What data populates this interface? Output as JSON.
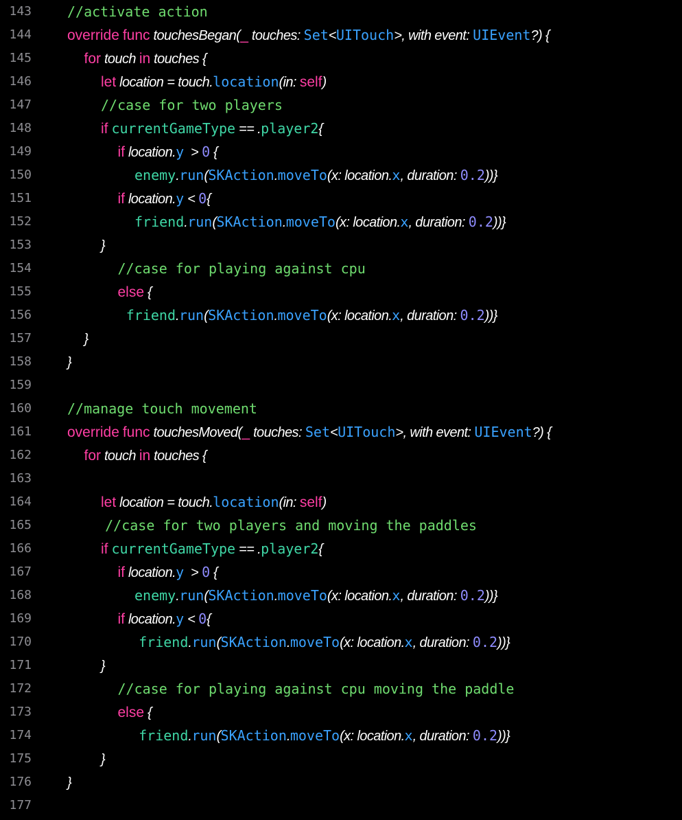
{
  "editor": {
    "colors": {
      "background": "#000000",
      "line_number": "#8e8e93",
      "plain": "#ffffff",
      "keyword": "#ff3fa4",
      "type": "#3aa2ff",
      "method": "#3aa2ff",
      "property": "#3fd7a6",
      "comment": "#6fdc6f",
      "number": "#8f8cff"
    },
    "lines": [
      {
        "num": "143",
        "indent": 0,
        "tokens": [
          {
            "t": "comment",
            "v": "//activate action"
          }
        ]
      },
      {
        "num": "144",
        "indent": 0,
        "tokens": [
          {
            "t": "kw",
            "v": "override"
          },
          {
            "t": "plain",
            "v": " "
          },
          {
            "t": "kw",
            "v": "func"
          },
          {
            "t": "plain",
            "v": " touchesBegan("
          },
          {
            "t": "kw",
            "v": "_"
          },
          {
            "t": "plain",
            "v": " touches: "
          },
          {
            "t": "type",
            "v": "Set"
          },
          {
            "t": "plain",
            "v": "<"
          },
          {
            "t": "type",
            "v": "UITouch"
          },
          {
            "t": "plain",
            "v": ">, with event: "
          },
          {
            "t": "type",
            "v": "UIEvent"
          },
          {
            "t": "plain",
            "v": "?) {"
          }
        ]
      },
      {
        "num": "145",
        "indent": 1,
        "tokens": [
          {
            "t": "kw",
            "v": "for"
          },
          {
            "t": "plain",
            "v": " touch "
          },
          {
            "t": "kw",
            "v": "in"
          },
          {
            "t": "plain",
            "v": " touches {"
          }
        ]
      },
      {
        "num": "146",
        "indent": 2,
        "tokens": [
          {
            "t": "kw",
            "v": "let"
          },
          {
            "t": "plain",
            "v": " location = touch."
          },
          {
            "t": "method",
            "v": "location"
          },
          {
            "t": "plain",
            "v": "(in: "
          },
          {
            "t": "kw",
            "v": "self"
          },
          {
            "t": "plain",
            "v": ")"
          }
        ]
      },
      {
        "num": "147",
        "indent": 2,
        "tokens": [
          {
            "t": "comment",
            "v": "//case for two players"
          }
        ]
      },
      {
        "num": "148",
        "indent": 2,
        "tokens": [
          {
            "t": "kw",
            "v": "if"
          },
          {
            "t": "plain",
            "v": " "
          },
          {
            "t": "prop",
            "v": "currentGameType"
          },
          {
            "t": "plain",
            "v": " == ."
          },
          {
            "t": "prop",
            "v": "player2"
          },
          {
            "t": "plain",
            "v": "{"
          }
        ]
      },
      {
        "num": "149",
        "indent": 3,
        "tokens": [
          {
            "t": "kw",
            "v": "if"
          },
          {
            "t": "plain",
            "v": " location."
          },
          {
            "t": "method",
            "v": "y"
          },
          {
            "t": "plain",
            "v": "  > "
          },
          {
            "t": "num",
            "v": "0"
          },
          {
            "t": "plain",
            "v": " {"
          }
        ]
      },
      {
        "num": "150",
        "indent": 4,
        "tokens": [
          {
            "t": "prop",
            "v": "enemy"
          },
          {
            "t": "plain",
            "v": "."
          },
          {
            "t": "method",
            "v": "run"
          },
          {
            "t": "plain",
            "v": "("
          },
          {
            "t": "type",
            "v": "SKAction"
          },
          {
            "t": "plain",
            "v": "."
          },
          {
            "t": "method",
            "v": "moveTo"
          },
          {
            "t": "plain",
            "v": "(x: location."
          },
          {
            "t": "method",
            "v": "x"
          },
          {
            "t": "plain",
            "v": ", duration: "
          },
          {
            "t": "num",
            "v": "0.2"
          },
          {
            "t": "plain",
            "v": "))}"
          }
        ]
      },
      {
        "num": "151",
        "indent": 3,
        "tokens": [
          {
            "t": "kw",
            "v": "if"
          },
          {
            "t": "plain",
            "v": " location."
          },
          {
            "t": "method",
            "v": "y"
          },
          {
            "t": "plain",
            "v": " < "
          },
          {
            "t": "num",
            "v": "0"
          },
          {
            "t": "plain",
            "v": "{"
          }
        ]
      },
      {
        "num": "152",
        "indent": 4,
        "tokens": [
          {
            "t": "prop",
            "v": "friend"
          },
          {
            "t": "plain",
            "v": "."
          },
          {
            "t": "method",
            "v": "run"
          },
          {
            "t": "plain",
            "v": "("
          },
          {
            "t": "type",
            "v": "SKAction"
          },
          {
            "t": "plain",
            "v": "."
          },
          {
            "t": "method",
            "v": "moveTo"
          },
          {
            "t": "plain",
            "v": "(x: location."
          },
          {
            "t": "method",
            "v": "x"
          },
          {
            "t": "plain",
            "v": ", duration: "
          },
          {
            "t": "num",
            "v": "0.2"
          },
          {
            "t": "plain",
            "v": "))}"
          }
        ]
      },
      {
        "num": "153",
        "indent": 2,
        "tokens": [
          {
            "t": "plain",
            "v": "}"
          }
        ]
      },
      {
        "num": "154",
        "indent": 3,
        "tokens": [
          {
            "t": "comment",
            "v": "//case for playing against cpu"
          }
        ]
      },
      {
        "num": "155",
        "indent": 3,
        "tokens": [
          {
            "t": "kw",
            "v": "else"
          },
          {
            "t": "plain",
            "v": " {"
          }
        ]
      },
      {
        "num": "156",
        "indent": 3.5,
        "tokens": [
          {
            "t": "prop",
            "v": "friend"
          },
          {
            "t": "plain",
            "v": "."
          },
          {
            "t": "method",
            "v": "run"
          },
          {
            "t": "plain",
            "v": "("
          },
          {
            "t": "type",
            "v": "SKAction"
          },
          {
            "t": "plain",
            "v": "."
          },
          {
            "t": "method",
            "v": "moveTo"
          },
          {
            "t": "plain",
            "v": "(x: location."
          },
          {
            "t": "method",
            "v": "x"
          },
          {
            "t": "plain",
            "v": ", duration: "
          },
          {
            "t": "num",
            "v": "0.2"
          },
          {
            "t": "plain",
            "v": "))}"
          }
        ]
      },
      {
        "num": "157",
        "indent": 1,
        "tokens": [
          {
            "t": "plain",
            "v": "}"
          }
        ]
      },
      {
        "num": "158",
        "indent": 0,
        "tokens": [
          {
            "t": "plain",
            "v": "}"
          }
        ]
      },
      {
        "num": "159",
        "indent": 0,
        "tokens": []
      },
      {
        "num": "160",
        "indent": 0,
        "tokens": [
          {
            "t": "comment",
            "v": "//manage touch movement"
          }
        ]
      },
      {
        "num": "161",
        "indent": 0,
        "tokens": [
          {
            "t": "kw",
            "v": "override"
          },
          {
            "t": "plain",
            "v": " "
          },
          {
            "t": "kw",
            "v": "func"
          },
          {
            "t": "plain",
            "v": " touchesMoved("
          },
          {
            "t": "kw",
            "v": "_"
          },
          {
            "t": "plain",
            "v": " touches: "
          },
          {
            "t": "type",
            "v": "Set"
          },
          {
            "t": "plain",
            "v": "<"
          },
          {
            "t": "type",
            "v": "UITouch"
          },
          {
            "t": "plain",
            "v": ">, with event: "
          },
          {
            "t": "type",
            "v": "UIEvent"
          },
          {
            "t": "plain",
            "v": "?) {"
          }
        ]
      },
      {
        "num": "162",
        "indent": 1,
        "tokens": [
          {
            "t": "kw",
            "v": "for"
          },
          {
            "t": "plain",
            "v": " touch "
          },
          {
            "t": "kw",
            "v": "in"
          },
          {
            "t": "plain",
            "v": " touches {"
          }
        ]
      },
      {
        "num": "163",
        "indent": 0,
        "tokens": []
      },
      {
        "num": "164",
        "indent": 2,
        "tokens": [
          {
            "t": "kw",
            "v": "let"
          },
          {
            "t": "plain",
            "v": " location = touch."
          },
          {
            "t": "method",
            "v": "location"
          },
          {
            "t": "plain",
            "v": "(in: "
          },
          {
            "t": "kw",
            "v": "self"
          },
          {
            "t": "plain",
            "v": ")"
          }
        ]
      },
      {
        "num": "165",
        "indent": 2.25,
        "tokens": [
          {
            "t": "comment",
            "v": "//case for two players and moving the paddles"
          }
        ]
      },
      {
        "num": "166",
        "indent": 2,
        "tokens": [
          {
            "t": "kw",
            "v": "if"
          },
          {
            "t": "plain",
            "v": " "
          },
          {
            "t": "prop",
            "v": "currentGameType"
          },
          {
            "t": "plain",
            "v": " == ."
          },
          {
            "t": "prop",
            "v": "player2"
          },
          {
            "t": "plain",
            "v": "{"
          }
        ]
      },
      {
        "num": "167",
        "indent": 3,
        "tokens": [
          {
            "t": "kw",
            "v": "if"
          },
          {
            "t": "plain",
            "v": " location."
          },
          {
            "t": "method",
            "v": "y"
          },
          {
            "t": "plain",
            "v": "  > "
          },
          {
            "t": "num",
            "v": "0"
          },
          {
            "t": "plain",
            "v": " {"
          }
        ]
      },
      {
        "num": "168",
        "indent": 4,
        "tokens": [
          {
            "t": "prop",
            "v": "enemy"
          },
          {
            "t": "plain",
            "v": "."
          },
          {
            "t": "method",
            "v": "run"
          },
          {
            "t": "plain",
            "v": "("
          },
          {
            "t": "type",
            "v": "SKAction"
          },
          {
            "t": "plain",
            "v": "."
          },
          {
            "t": "method",
            "v": "moveTo"
          },
          {
            "t": "plain",
            "v": "(x: location."
          },
          {
            "t": "method",
            "v": "x"
          },
          {
            "t": "plain",
            "v": ", duration: "
          },
          {
            "t": "num",
            "v": "0.2"
          },
          {
            "t": "plain",
            "v": "))}"
          }
        ]
      },
      {
        "num": "169",
        "indent": 3,
        "tokens": [
          {
            "t": "kw",
            "v": "if"
          },
          {
            "t": "plain",
            "v": " location."
          },
          {
            "t": "method",
            "v": "y"
          },
          {
            "t": "plain",
            "v": " < "
          },
          {
            "t": "num",
            "v": "0"
          },
          {
            "t": "plain",
            "v": "{"
          }
        ]
      },
      {
        "num": "170",
        "indent": 4.25,
        "tokens": [
          {
            "t": "prop",
            "v": "friend"
          },
          {
            "t": "plain",
            "v": "."
          },
          {
            "t": "method",
            "v": "run"
          },
          {
            "t": "plain",
            "v": "("
          },
          {
            "t": "type",
            "v": "SKAction"
          },
          {
            "t": "plain",
            "v": "."
          },
          {
            "t": "method",
            "v": "moveTo"
          },
          {
            "t": "plain",
            "v": "(x: location."
          },
          {
            "t": "method",
            "v": "x"
          },
          {
            "t": "plain",
            "v": ", duration: "
          },
          {
            "t": "num",
            "v": "0.2"
          },
          {
            "t": "plain",
            "v": "))}"
          }
        ]
      },
      {
        "num": "171",
        "indent": 2,
        "tokens": [
          {
            "t": "plain",
            "v": "}"
          }
        ]
      },
      {
        "num": "172",
        "indent": 3,
        "tokens": [
          {
            "t": "comment",
            "v": "//case for playing against cpu moving the paddle"
          }
        ]
      },
      {
        "num": "173",
        "indent": 3,
        "tokens": [
          {
            "t": "kw",
            "v": "else"
          },
          {
            "t": "plain",
            "v": " {"
          }
        ]
      },
      {
        "num": "174",
        "indent": 4.25,
        "tokens": [
          {
            "t": "prop",
            "v": "friend"
          },
          {
            "t": "plain",
            "v": "."
          },
          {
            "t": "method",
            "v": "run"
          },
          {
            "t": "plain",
            "v": "("
          },
          {
            "t": "type",
            "v": "SKAction"
          },
          {
            "t": "plain",
            "v": "."
          },
          {
            "t": "method",
            "v": "moveTo"
          },
          {
            "t": "plain",
            "v": "(x: location."
          },
          {
            "t": "method",
            "v": "x"
          },
          {
            "t": "plain",
            "v": ", duration: "
          },
          {
            "t": "num",
            "v": "0.2"
          },
          {
            "t": "plain",
            "v": "))}"
          }
        ]
      },
      {
        "num": "175",
        "indent": 2,
        "tokens": [
          {
            "t": "plain",
            "v": "}"
          }
        ]
      },
      {
        "num": "176",
        "indent": 0,
        "tokens": [
          {
            "t": "plain",
            "v": "}"
          }
        ]
      },
      {
        "num": "177",
        "indent": 0,
        "tokens": []
      }
    ]
  }
}
